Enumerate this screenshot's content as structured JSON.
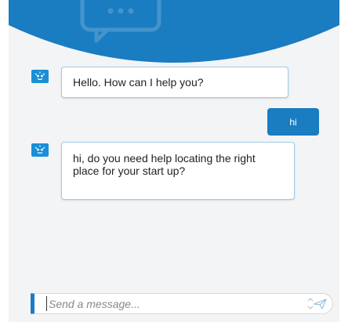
{
  "messages": [
    {
      "sender": "bot",
      "text": "Hello. How can I help you?"
    },
    {
      "sender": "user",
      "text": "hi"
    },
    {
      "sender": "bot",
      "text": "hi, do you need help locating the right place for your start up?"
    }
  ],
  "composer": {
    "placeholder": "Send a message...",
    "value": ""
  },
  "icons": {
    "header": "chat-bubble-icon",
    "avatar": "bot-icon",
    "send": "send-icon"
  },
  "colors": {
    "header_blue": "#1a7cc1",
    "user_bubble": "#1a7cc1",
    "bot_avatar": "#1a8fd6",
    "bot_bubble_border": "#9fcbe9",
    "background": "#f3f4f5"
  }
}
